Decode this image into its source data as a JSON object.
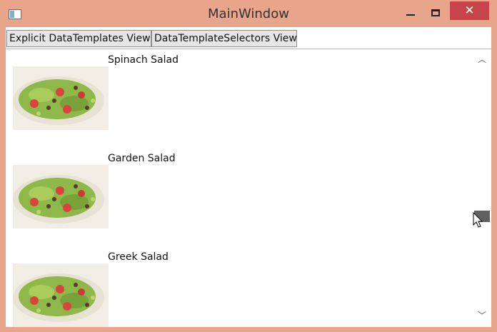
{
  "window": {
    "title": "MainWindow",
    "close_glyph": "✕"
  },
  "tabs": [
    {
      "label": "Explicit DataTemplates View"
    },
    {
      "label": "DataTemplateSelectors View"
    }
  ],
  "items": [
    {
      "name": "Spinach Salad",
      "image": "salad-photo"
    },
    {
      "name": "Garden Salad",
      "image": "salad-photo"
    },
    {
      "name": "Greek Salad",
      "image": "salad-photo"
    }
  ],
  "scrollbar": {
    "position": 0.62
  },
  "colors": {
    "frame": "#e9a58c",
    "close": "#c7444a",
    "background": "#ffffff"
  }
}
